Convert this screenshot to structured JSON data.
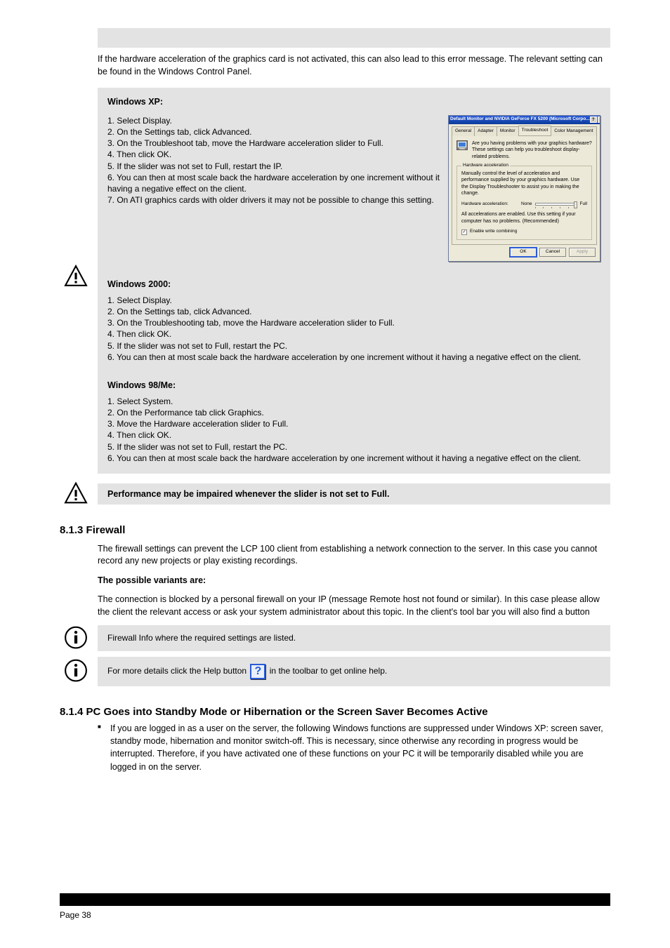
{
  "intro": "If the hardware acceleration of the graphics card is not activated, this can also lead to this error message. The relevant setting can be found in the Windows Control Panel.",
  "box1": {
    "title": "Windows XP:",
    "steps_intro": "",
    "steps": [
      "1. Select Display.",
      "2. On the Settings tab, click Advanced.",
      "3. On the Troubleshoot tab, move the Hardware acceleration slider to Full.",
      "4. Then click OK.",
      "5. If the slider was not set to Full, restart the IP.",
      "6. You can then at most scale back the hardware acceleration by one increment without it having a negative effect on the client.",
      "7. On ATI graphics cards with older drivers it may not be possible to change this setting."
    ],
    "win2k_title": "Windows 2000:",
    "win2k_steps": [
      "1. Select Display.",
      "2. On the Settings tab, click Advanced.",
      "3. On the Troubleshooting tab, move the Hardware acceleration slider to Full.",
      "4. Then click OK.",
      "5. If the slider was not set to Full, restart the PC.",
      "6. You can then at most scale back the hardware acceleration by one increment without it having a negative effect on the client."
    ],
    "win98_title": "Windows 98/Me:",
    "win98_steps": [
      "1. Select System.",
      "2. On the Performance tab click Graphics.",
      "3. Move the Hardware acceleration slider to Full.",
      "4. Then click OK.",
      "5. If the slider was not set to Full, restart the PC.",
      "6. You can then at most scale back the hardware acceleration by one increment without it having a negative effect on the client."
    ]
  },
  "dialog": {
    "title": "Default Monitor and NVIDIA GeForce FX 5200 (Microsoft Corpo...",
    "tabs": [
      "General",
      "Adapter",
      "Monitor",
      "Troubleshoot",
      "Color Management"
    ],
    "intro_text": "Are you having problems with your graphics hardware? These settings can help you troubleshoot display-related problems.",
    "fieldset_legend": "Hardware acceleration",
    "fieldset_desc": "Manually control the level of acceleration and performance supplied by your graphics hardware. Use the Display Troubleshooter to assist you in making the change.",
    "slider_label": "Hardware acceleration:",
    "slider_none": "None",
    "slider_full": "Full",
    "slider_status": "All accelerations are enabled. Use this setting if your computer has no problems. (Recommended)",
    "write_combine": "Enable write combining",
    "ok": "OK",
    "cancel": "Cancel",
    "apply": "Apply"
  },
  "perf_warning": "Performance may be impaired whenever the slider is not set to Full.",
  "sec813": {
    "heading": "8.1.3 Firewall",
    "intro": "The firewall settings can prevent the LCP 100 client from establishing a network connection to the server. In this case you cannot record any new projects or play existing recordings.",
    "variants_title": "The possible variants are:",
    "body": "The connection is blocked by a personal firewall on your IP (message Remote host not found or similar). In this case please allow the client the relevant access or ask your system administrator about this topic. In the client's tool bar you will also find a button"
  },
  "tips": {
    "firewall": "Firewall Info where the required settings are listed.",
    "help_prefix": "For more details click the Help button ",
    "help_suffix": " in the toolbar to get online help."
  },
  "sec814": {
    "heading": "8.1.4 PC Goes into Standby Mode or Hibernation or the Screen Saver Becomes Active",
    "bullet": "If you are logged in as a user on the server, the following Windows functions are suppressed under Windows XP: screen saver, standby mode, hibernation and monitor switch-off. This is necessary, since otherwise any recording in progress would be interrupted. Therefore, if you have activated one of these functions on your PC it will be temporarily disabled while you are logged in on the server."
  },
  "footer": {
    "page_label": "Page",
    "page_num": "38"
  }
}
